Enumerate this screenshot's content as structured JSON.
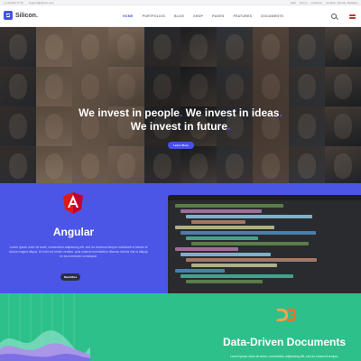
{
  "topbar": {
    "phone": "+1 00 000 77 00",
    "email": "support@silicon.com",
    "links": [
      "Help",
      "Forum",
      "LiveDocs"
    ],
    "location": "Location: Plovdiv, Bulgaria"
  },
  "header": {
    "logo_text": "Silicon.",
    "nav": [
      {
        "label": "Home",
        "active": true
      },
      {
        "label": "Portfolios",
        "active": false
      },
      {
        "label": "Blog",
        "active": false
      },
      {
        "label": "Shop",
        "active": false
      },
      {
        "label": "Pages",
        "active": false
      },
      {
        "label": "Features",
        "active": false
      },
      {
        "label": "Documents",
        "active": false
      }
    ],
    "icons": [
      "search-icon",
      "flag-icon"
    ]
  },
  "hero": {
    "line1_a": "We invest in people",
    "line1_b": "We invest in ideas",
    "line2": "We invest in future",
    "dot": ".",
    "button": "Learn More"
  },
  "angular": {
    "title": "Angular",
    "description": "Lorem ipsum dolor sit amet, consectetur adipisicing elit, sed do eiusmod tempor incididunt ut labore et dolore magna aliqua. Ut enim ad minim veniam, quis nostrud exercitation ullamco laboris nisi ut aliquip ex ea commodo consequat.",
    "button": "Read More"
  },
  "d3": {
    "title": "Data-Driven Documents",
    "description": "Lorem ipsum dolor sit amet, consectetur adipisicing elit, sed do eiusmod tempor."
  },
  "colors": {
    "accent": "#4452e8",
    "angular_bg": "#4c56e6",
    "d3_bg": "#2ec08a",
    "angular_red": "#dd1b16"
  }
}
